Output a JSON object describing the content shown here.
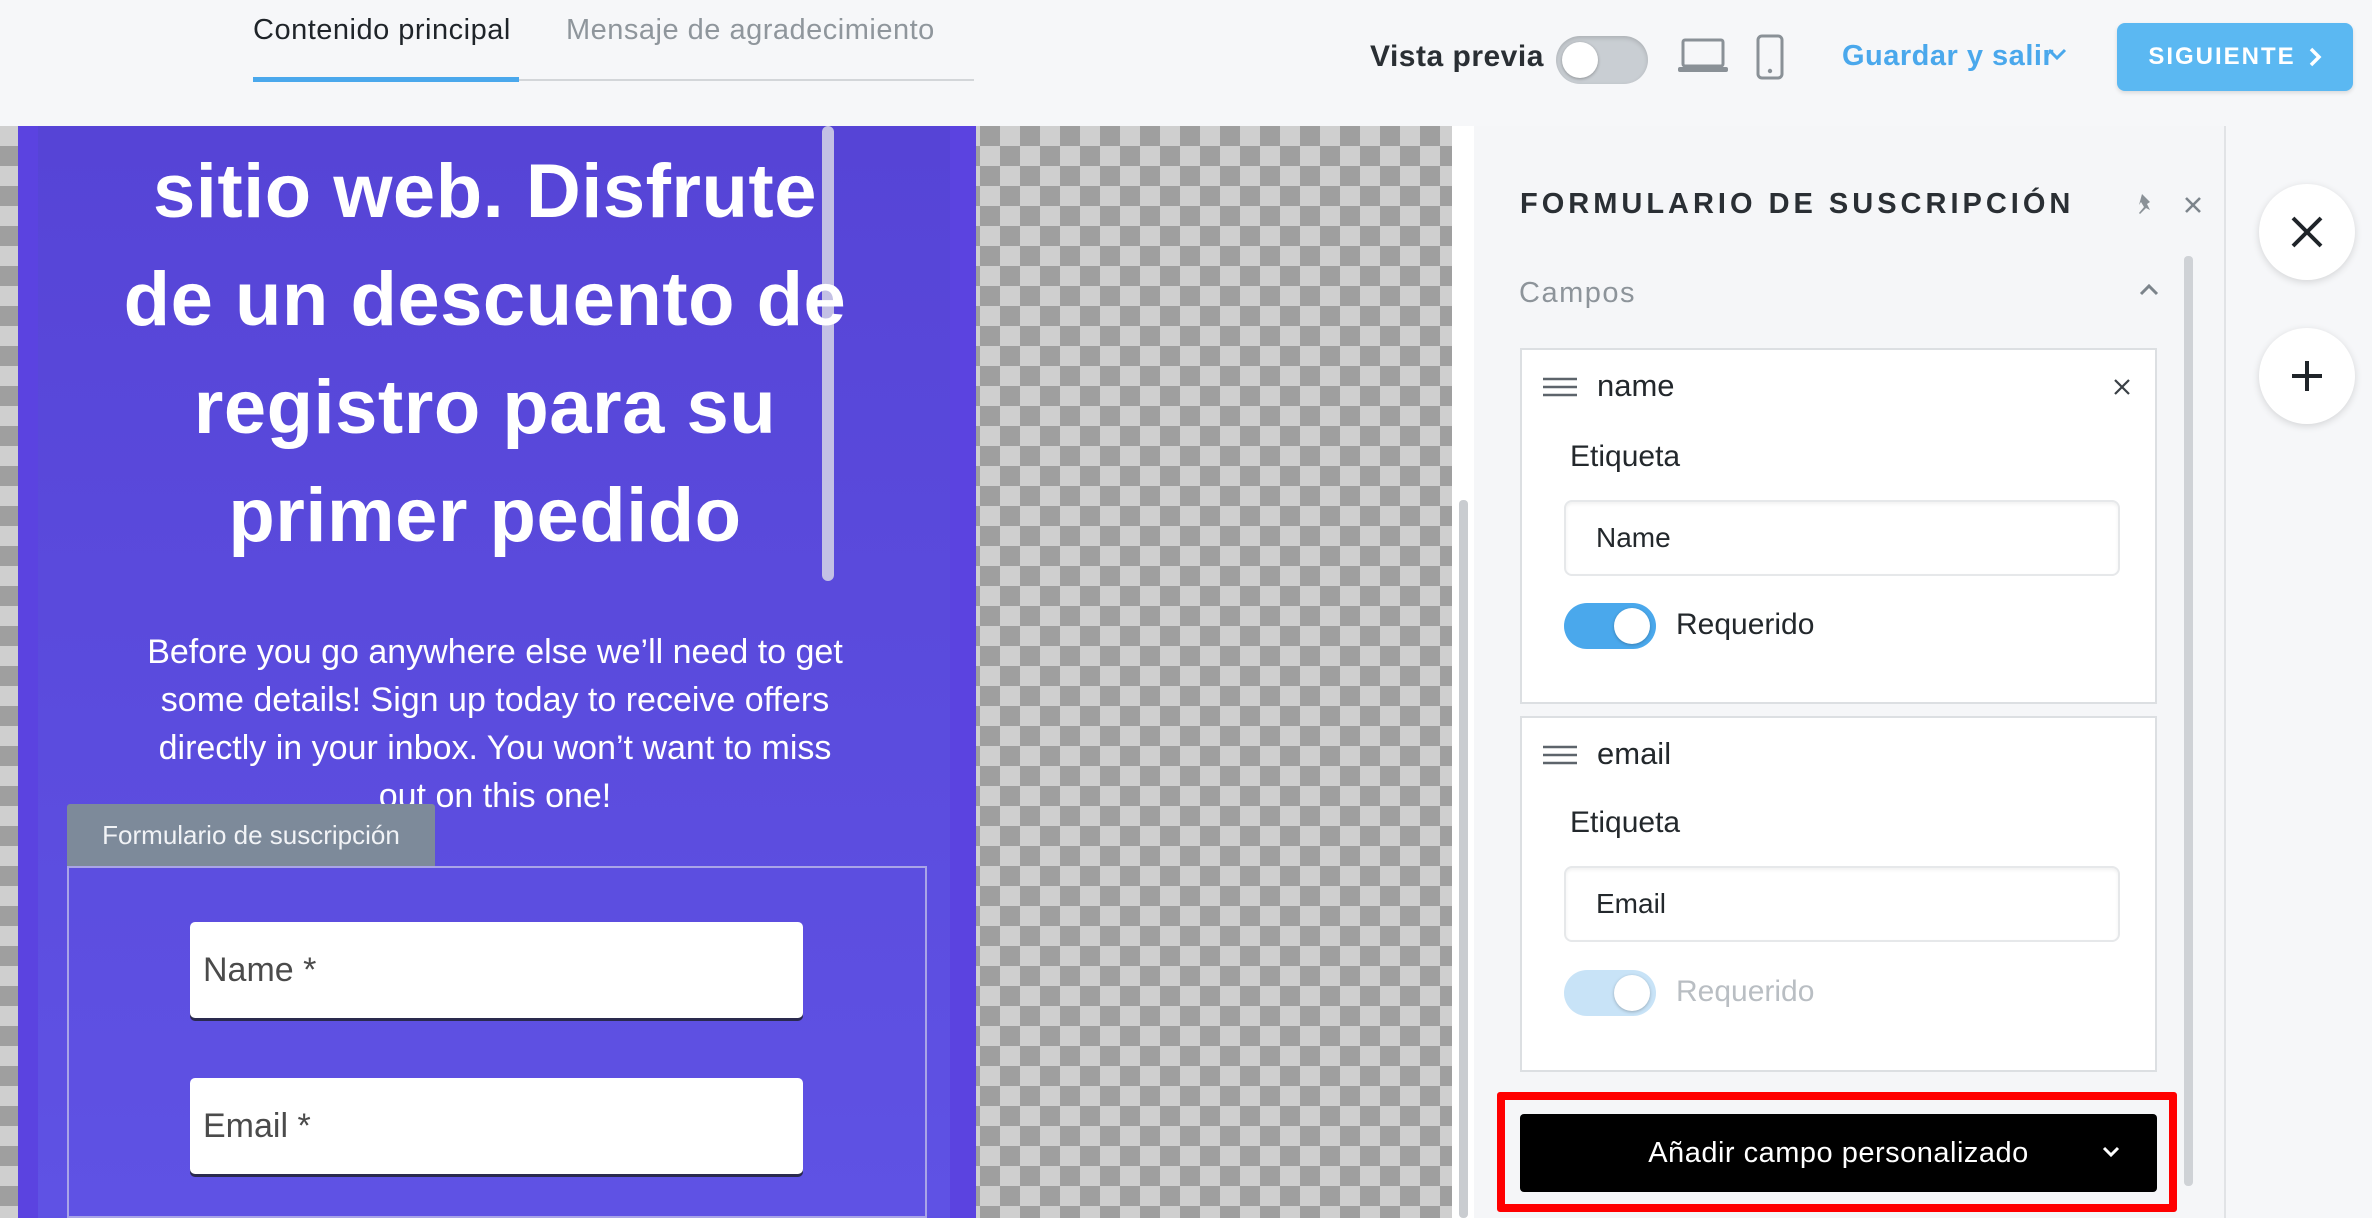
{
  "tabs": {
    "main": "Contenido principal",
    "thanks": "Mensaje de agradecimiento"
  },
  "header": {
    "preview_label": "Vista previa",
    "save_exit": "Guardar y salir",
    "next": "SIGUIENTE",
    "preview_enabled": false
  },
  "popup": {
    "headline": "sitio web. Disfrute de un descuento de registro para su primer pedido",
    "body": "Before you go anywhere else we’ll need to get some details! Sign up today to receive offers directly in your inbox. You won’t want to miss out on this one!",
    "form_tag": "Formulario de suscripción",
    "name_placeholder": "Name *",
    "email_placeholder": "Email *"
  },
  "panel": {
    "title": "FORMULARIO DE SUSCRIPCIÓN",
    "section": "Campos",
    "fields": [
      {
        "key": "name",
        "label_caption": "Etiqueta",
        "label_value": "Name",
        "required_label": "Requerido",
        "required": true,
        "required_disabled": false
      },
      {
        "key": "email",
        "label_caption": "Etiqueta",
        "label_value": "Email",
        "required_label": "Requerido",
        "required": true,
        "required_disabled": true
      }
    ],
    "add_field": "Añadir campo personalizado"
  },
  "colors": {
    "accent": "#4aa8ec",
    "popup_bg": "#5b43e0",
    "highlight": "#ff0000"
  }
}
